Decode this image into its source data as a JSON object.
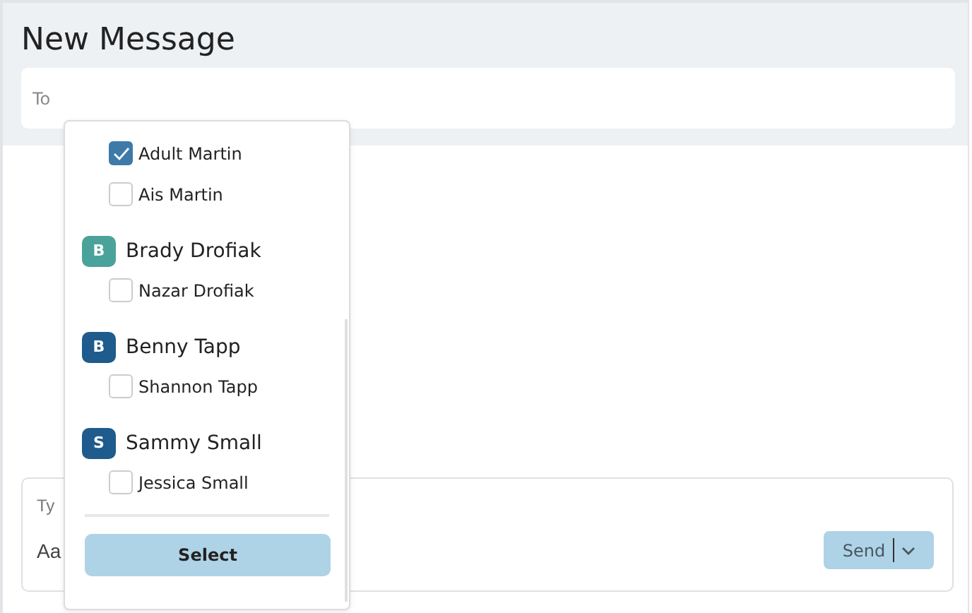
{
  "title": "New Message",
  "to_field": {
    "placeholder": "To"
  },
  "recipients": [
    {
      "kind": "member",
      "name": "Adult Martin",
      "checked": true
    },
    {
      "kind": "member",
      "name": "Ais Martin",
      "checked": false
    },
    {
      "kind": "family",
      "initial": "B",
      "name": "Brady Drofiak",
      "color": "#4aa39a"
    },
    {
      "kind": "member",
      "name": "Nazar Drofiak",
      "checked": false
    },
    {
      "kind": "family",
      "initial": "B",
      "name": "Benny Tapp",
      "color": "#1f5b8c"
    },
    {
      "kind": "member",
      "name": "Shannon Tapp",
      "checked": false
    },
    {
      "kind": "family",
      "initial": "S",
      "name": "Sammy Small",
      "color": "#1f5b8c"
    },
    {
      "kind": "member",
      "name": "Jessica Small",
      "checked": false
    }
  ],
  "select_button": "Select",
  "composer": {
    "subject_hint": "Ty",
    "body_hint": "Aa",
    "send_button": "Send"
  }
}
